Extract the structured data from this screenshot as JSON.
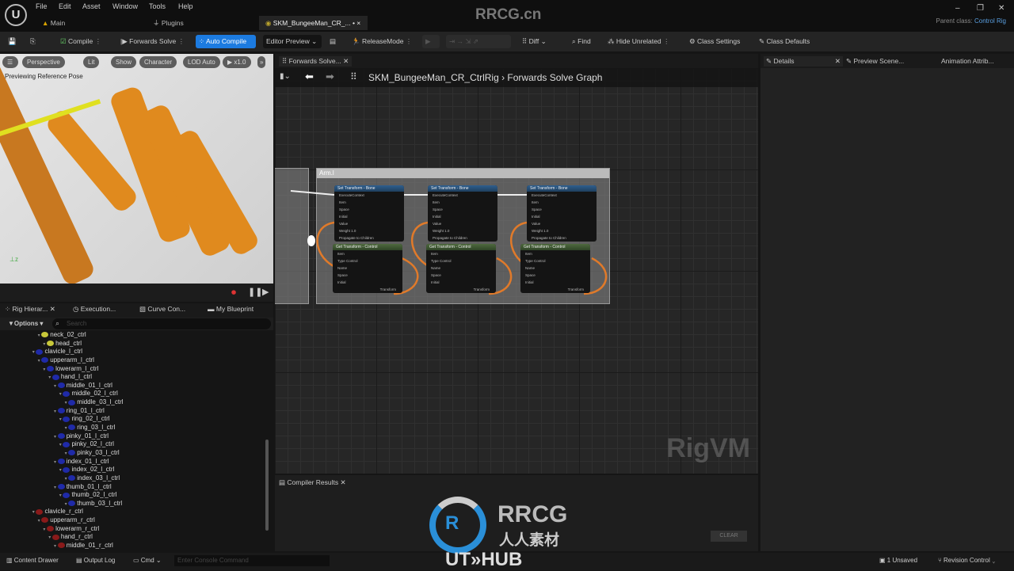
{
  "menu": [
    "File",
    "Edit",
    "Asset",
    "Window",
    "Tools",
    "Help"
  ],
  "doc_tabs": [
    {
      "label": "Main"
    },
    {
      "label": "Plugins"
    },
    {
      "label": "SKM_BungeeMan_CR_..."
    }
  ],
  "watermark": "RRCG.cn",
  "parent_class": {
    "label": "Parent class:",
    "value": "Control Rig"
  },
  "toolbar": {
    "compile": "Compile",
    "forwards_solve": "Forwards Solve",
    "auto_compile": "Auto Compile",
    "editor_preview": "Editor Preview",
    "release_mode": "ReleaseMode",
    "diff": "Diff",
    "find": "Find",
    "hide_unrelated": "Hide Unrelated",
    "class_settings": "Class Settings",
    "class_defaults": "Class Defaults"
  },
  "viewport": {
    "buttons": [
      "Perspective",
      "Lit",
      "Show",
      "Character",
      "LOD Auto",
      "x1.0"
    ],
    "overlay_text": "Previewing Reference Pose"
  },
  "left_tabs": [
    "Rig Hierar...",
    "Execution...",
    "Curve Con...",
    "My Blueprint"
  ],
  "options_label": "Options",
  "search_placeholder": "Search",
  "tree": [
    {
      "label": "neck_02_ctrl",
      "depth": 2,
      "color": "#c8c83a"
    },
    {
      "label": "head_ctrl",
      "depth": 3,
      "color": "#c8c83a"
    },
    {
      "label": "clavicle_l_ctrl",
      "depth": 1,
      "color": "#1f2aa8"
    },
    {
      "label": "upperarm_l_ctrl",
      "depth": 2,
      "color": "#1f2aa8"
    },
    {
      "label": "lowerarm_l_ctrl",
      "depth": 3,
      "color": "#1f2aa8"
    },
    {
      "label": "hand_l_ctrl",
      "depth": 4,
      "color": "#1f2aa8"
    },
    {
      "label": "middle_01_l_ctrl",
      "depth": 5,
      "color": "#1f2aa8"
    },
    {
      "label": "middle_02_l_ctrl",
      "depth": 6,
      "color": "#1f2aa8"
    },
    {
      "label": "middle_03_l_ctrl",
      "depth": 7,
      "color": "#1f2aa8"
    },
    {
      "label": "ring_01_l_ctrl",
      "depth": 5,
      "color": "#1f2aa8"
    },
    {
      "label": "ring_02_l_ctrl",
      "depth": 6,
      "color": "#1f2aa8"
    },
    {
      "label": "ring_03_l_ctrl",
      "depth": 7,
      "color": "#1f2aa8"
    },
    {
      "label": "pinky_01_l_ctrl",
      "depth": 5,
      "color": "#1f2aa8"
    },
    {
      "label": "pinky_02_l_ctrl",
      "depth": 6,
      "color": "#1f2aa8"
    },
    {
      "label": "pinky_03_l_ctrl",
      "depth": 7,
      "color": "#1f2aa8"
    },
    {
      "label": "index_01_l_ctrl",
      "depth": 5,
      "color": "#1f2aa8"
    },
    {
      "label": "index_02_l_ctrl",
      "depth": 6,
      "color": "#1f2aa8"
    },
    {
      "label": "index_03_l_ctrl",
      "depth": 7,
      "color": "#1f2aa8"
    },
    {
      "label": "thumb_01_l_ctrl",
      "depth": 5,
      "color": "#1f2aa8"
    },
    {
      "label": "thumb_02_l_ctrl",
      "depth": 6,
      "color": "#1f2aa8"
    },
    {
      "label": "thumb_03_l_ctrl",
      "depth": 7,
      "color": "#1f2aa8"
    },
    {
      "label": "clavicle_r_ctrl",
      "depth": 1,
      "color": "#8a1a1a"
    },
    {
      "label": "upperarm_r_ctrl",
      "depth": 2,
      "color": "#8a1a1a"
    },
    {
      "label": "lowerarm_r_ctrl",
      "depth": 3,
      "color": "#8a1a1a"
    },
    {
      "label": "hand_r_ctrl",
      "depth": 4,
      "color": "#8a1a1a"
    },
    {
      "label": "middle_01_r_ctrl",
      "depth": 5,
      "color": "#8a1a1a"
    }
  ],
  "graph": {
    "tab": "Forwards Solve...",
    "breadcrumb_asset": "SKM_BungeeMan_CR_CtrlRig",
    "breadcrumb_graph": "Forwards Solve Graph",
    "comment": "Arm.l",
    "watermark": "RigVM",
    "bone_node": {
      "title": "Set Transform - Bone",
      "rows": [
        "ExecuteContext",
        "Item",
        "Space",
        "Initial",
        "Value",
        "Weight 1.0",
        "Propagate to Children"
      ]
    },
    "ctrl_node": {
      "title": "Get Transform - Control",
      "rows": [
        "Item",
        "Type  Control",
        "Name",
        "Space",
        "Initial",
        "Transform"
      ]
    }
  },
  "compiler": {
    "tab": "Compiler Results",
    "clear": "CLEAR"
  },
  "right_tabs": [
    "Details",
    "Preview Scene...",
    "Animation Attrib..."
  ],
  "status": {
    "content_drawer": "Content Drawer",
    "output_log": "Output Log",
    "cmd": "Cmd",
    "console_placeholder": "Enter Console Command",
    "unsaved": "1 Unsaved",
    "revision": "Revision Control"
  },
  "overlay_logo": {
    "brand": "RRCG",
    "sub": "人人素材",
    "bottom": "UT»HUB"
  }
}
